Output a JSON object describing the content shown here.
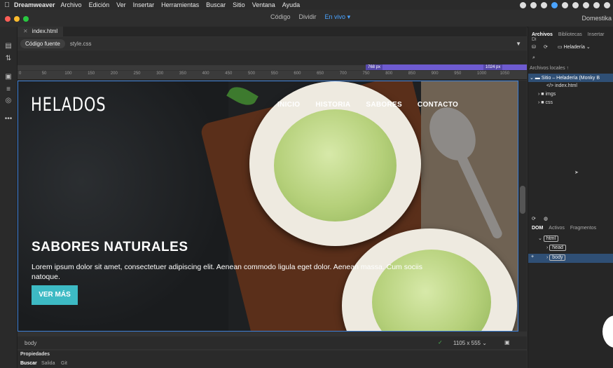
{
  "menubar": {
    "app_name": "Dreamweaver",
    "items": [
      "Archivo",
      "Edición",
      "Ver",
      "Insertar",
      "Herramientas",
      "Buscar",
      "Sitio",
      "Ventana",
      "Ayuda"
    ]
  },
  "app_header": {
    "view_modes": [
      "Código",
      "Dividir",
      "En vivo"
    ],
    "active_view": "En vivo",
    "workspace": "Domestika"
  },
  "document": {
    "tab_name": "index.html",
    "related_files": [
      "Código fuente",
      "style.css"
    ]
  },
  "media_queries": {
    "min_label": "768  px",
    "max_label": "1024  px"
  },
  "ruler_ticks": [
    "0",
    "50",
    "100",
    "150",
    "200",
    "250",
    "300",
    "350",
    "400",
    "450",
    "500",
    "550",
    "600",
    "650",
    "700",
    "750",
    "800",
    "850",
    "900",
    "950",
    "1000",
    "1050"
  ],
  "page": {
    "logo": "HELADOS",
    "nav": [
      "INICIO",
      "HISTORIA",
      "SABORES",
      "CONTACTO"
    ],
    "hero_title": "SABORES NATURALES",
    "hero_text": "Lorem ipsum dolor sit amet, consectetuer adipiscing elit. Aenean commodo ligula eget dolor. Aenean massa. Cum sociis natoque.",
    "hero_button": "VER MÁS",
    "accent_color": "#3dbac4"
  },
  "statusbar": {
    "tag": "body",
    "viewport_size": "1105 x 555"
  },
  "properties": {
    "title": "Propiedades",
    "tabs": [
      "Buscar",
      "Salida",
      "Git"
    ]
  },
  "files_panel": {
    "tabs": [
      "Archivos",
      "Bibliotecas",
      "Insertar",
      "Di"
    ],
    "site_select": "Heladería",
    "section_label": "Archivos locales",
    "tree": [
      {
        "label": "Sitio – Heladería (Monky B",
        "level": 0
      },
      {
        "label": "index.html",
        "level": 1
      },
      {
        "label": "imgs",
        "level": 1
      },
      {
        "label": "css",
        "level": 1
      }
    ]
  },
  "dom_panel": {
    "tabs": [
      "DOM",
      "Activos",
      "Fragmentos"
    ],
    "nodes": [
      "html",
      "head",
      "body"
    ]
  }
}
